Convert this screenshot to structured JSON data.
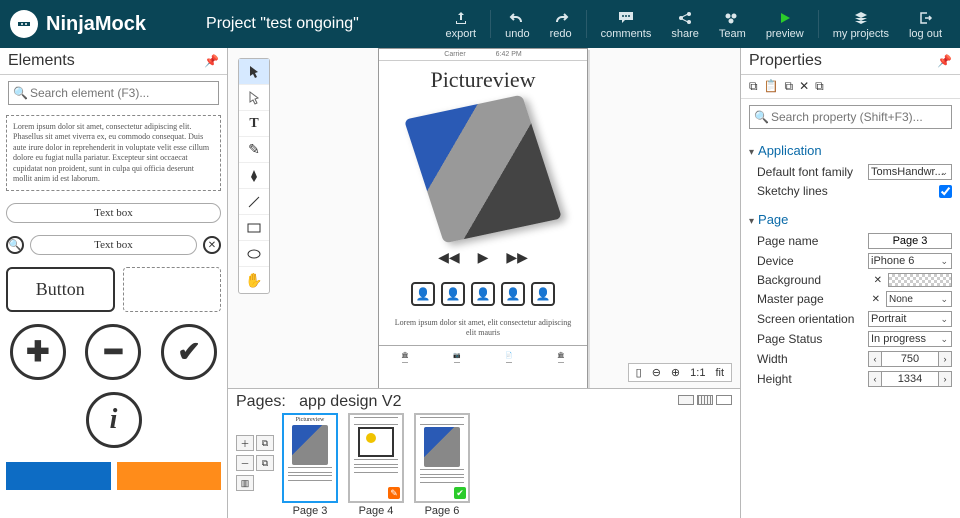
{
  "app": {
    "name": "NinjaMock",
    "project_title": "Project \"test ongoing\""
  },
  "header_buttons": {
    "export": "export",
    "undo": "undo",
    "redo": "redo",
    "comments": "comments",
    "share": "share",
    "team": "Team",
    "preview": "preview",
    "my_projects": "my projects",
    "logout": "log out"
  },
  "elements_panel": {
    "title": "Elements",
    "search_placeholder": "Search element (F3)...",
    "lorem": "Lorem ipsum dolor sit amet, consectetur adipiscing elit. Phasellus sit amet viverra ex, eu commodo consequat. Duis aute irure dolor in reprehenderit in voluptate velit esse cillum dolore eu fugiat nulla pariatur. Excepteur sint occaecat cupidatat non proident, sunt in culpa qui officia deserunt mollit anim id est laborum.",
    "textbox_label": "Text box",
    "button_label": "Button"
  },
  "canvas": {
    "preview_title": "Pictureview",
    "preview_lorem": "Lorem ipsum dolor sit amet, elit consectetur adipiscing elit mauris",
    "status_time": "6:42 PM",
    "carrier": "Carrier",
    "zoom": {
      "ratio": "1:1",
      "fit": "fit"
    }
  },
  "pages_strip": {
    "label": "Pages:",
    "collection_name": "app design V2",
    "pages": [
      {
        "name": "Page 3",
        "active": true
      },
      {
        "name": "Page 4",
        "badge": "orange"
      },
      {
        "name": "Page 6",
        "badge": "green"
      }
    ]
  },
  "properties_panel": {
    "title": "Properties",
    "search_placeholder": "Search property (Shift+F3)...",
    "sections": {
      "application": {
        "title": "Application",
        "default_font_label": "Default font family",
        "default_font_value": "TomsHandwr...",
        "sketchy_label": "Sketchy lines",
        "sketchy_checked": true
      },
      "page": {
        "title": "Page",
        "page_name_label": "Page name",
        "page_name_value": "Page 3",
        "device_label": "Device",
        "device_value": "iPhone 6",
        "background_label": "Background",
        "master_label": "Master page",
        "master_value": "None",
        "orientation_label": "Screen orientation",
        "orientation_value": "Portrait",
        "status_label": "Page Status",
        "status_value": "In progress",
        "width_label": "Width",
        "width_value": "750",
        "height_label": "Height",
        "height_value": "1334"
      }
    }
  }
}
